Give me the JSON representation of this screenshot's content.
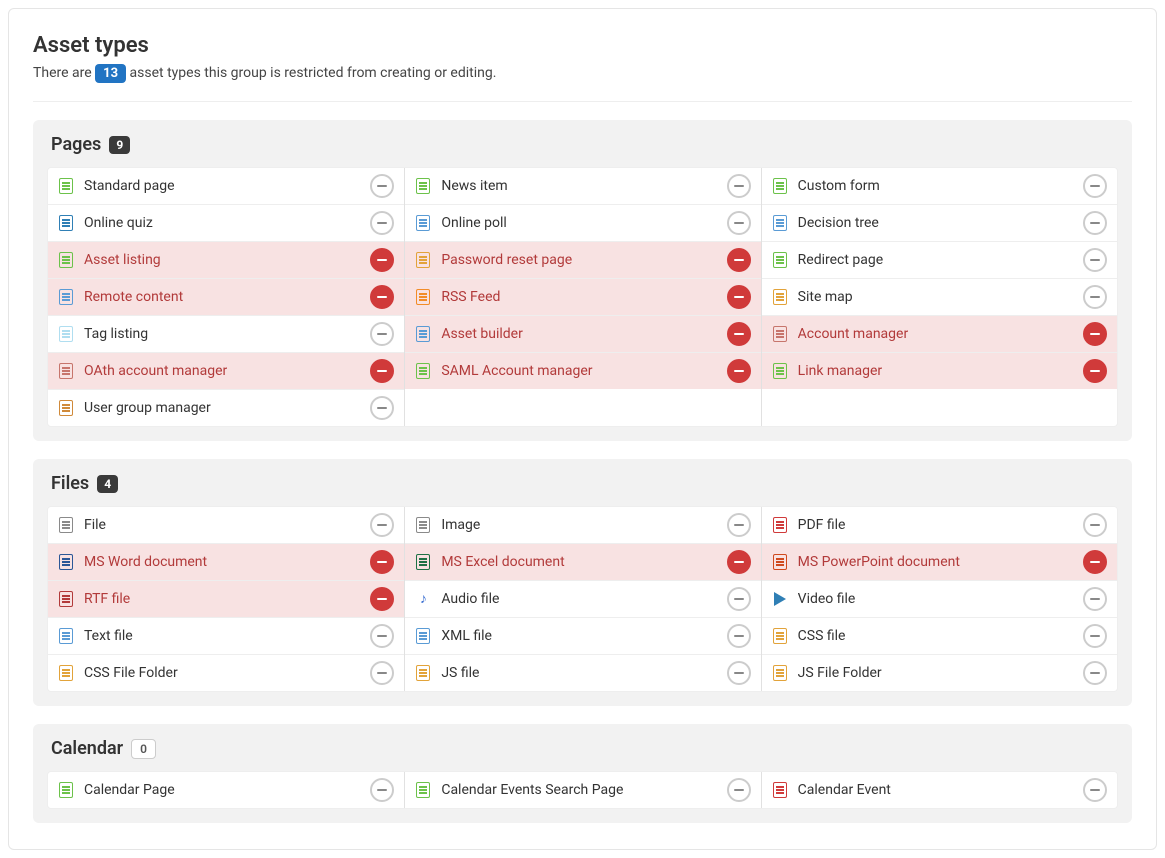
{
  "header": {
    "title": "Asset types",
    "subtitle_pre": "There are",
    "count": "13",
    "subtitle_post": "asset types this group is restricted from creating or editing."
  },
  "icons": {
    "page-green": {
      "kind": "doc",
      "color": "#6cc24a"
    },
    "quiz": {
      "kind": "doc",
      "color": "#2f7fb5"
    },
    "asset-listing": {
      "kind": "doc",
      "color": "#6cc24a"
    },
    "remote": {
      "kind": "doc",
      "color": "#5a9bd5"
    },
    "tag": {
      "kind": "doc",
      "color": "#b0def0"
    },
    "oauth": {
      "kind": "doc",
      "color": "#c7756c"
    },
    "user-group": {
      "kind": "doc",
      "color": "#d08a3a"
    },
    "news": {
      "kind": "doc",
      "color": "#6cc24a"
    },
    "poll": {
      "kind": "doc",
      "color": "#5a9bd5"
    },
    "password": {
      "kind": "doc",
      "color": "#e2a33a"
    },
    "rss": {
      "kind": "doc",
      "color": "#f28c28"
    },
    "builder": {
      "kind": "doc",
      "color": "#5a9bd5"
    },
    "saml": {
      "kind": "doc",
      "color": "#6cc24a"
    },
    "form": {
      "kind": "doc",
      "color": "#6cc24a"
    },
    "decision": {
      "kind": "doc",
      "color": "#5a9bd5"
    },
    "redirect": {
      "kind": "doc",
      "color": "#6cc24a"
    },
    "sitemap": {
      "kind": "doc",
      "color": "#e2a33a"
    },
    "account-mgr": {
      "kind": "doc",
      "color": "#c7756c"
    },
    "link-mgr": {
      "kind": "doc",
      "color": "#6cc24a"
    },
    "file": {
      "kind": "doc",
      "color": "#8a8a8a"
    },
    "word": {
      "kind": "doc",
      "color": "#2b5797"
    },
    "rtf": {
      "kind": "doc",
      "color": "#b23a3a"
    },
    "text": {
      "kind": "doc",
      "color": "#5a9bd5"
    },
    "css-folder": {
      "kind": "doc",
      "color": "#e2a33a"
    },
    "image": {
      "kind": "doc",
      "color": "#8a8a8a"
    },
    "excel": {
      "kind": "doc",
      "color": "#1e7145"
    },
    "audio": {
      "kind": "note",
      "color": "#3b6fd1",
      "glyph": "♪"
    },
    "xml": {
      "kind": "doc",
      "color": "#5a9bd5"
    },
    "js": {
      "kind": "doc",
      "color": "#e2a33a"
    },
    "pdf": {
      "kind": "doc",
      "color": "#d03a3a"
    },
    "ppt": {
      "kind": "doc",
      "color": "#d04a1e"
    },
    "video": {
      "kind": "play",
      "color": "#2f7fb5"
    },
    "css": {
      "kind": "doc",
      "color": "#e2a33a"
    },
    "js-folder": {
      "kind": "doc",
      "color": "#e2a33a"
    },
    "cal-green": {
      "kind": "doc",
      "color": "#6cc24a"
    },
    "cal-red": {
      "kind": "doc",
      "color": "#d03a3a"
    }
  },
  "sections": [
    {
      "title": "Pages",
      "count": "9",
      "count_style": "dark",
      "columns": [
        [
          {
            "label": "Standard page",
            "restricted": false,
            "icon": "page-green"
          },
          {
            "label": "Online quiz",
            "restricted": false,
            "icon": "quiz"
          },
          {
            "label": "Asset listing",
            "restricted": true,
            "icon": "asset-listing"
          },
          {
            "label": "Remote content",
            "restricted": true,
            "icon": "remote"
          },
          {
            "label": "Tag listing",
            "restricted": false,
            "icon": "tag"
          },
          {
            "label": "OAth account manager",
            "restricted": true,
            "icon": "oauth"
          },
          {
            "label": "User group manager",
            "restricted": false,
            "icon": "user-group"
          }
        ],
        [
          {
            "label": "News item",
            "restricted": false,
            "icon": "news"
          },
          {
            "label": "Online poll",
            "restricted": false,
            "icon": "poll"
          },
          {
            "label": "Password reset page",
            "restricted": true,
            "icon": "password"
          },
          {
            "label": "RSS Feed",
            "restricted": true,
            "icon": "rss"
          },
          {
            "label": "Asset builder",
            "restricted": true,
            "icon": "builder"
          },
          {
            "label": "SAML Account manager",
            "restricted": true,
            "icon": "saml"
          }
        ],
        [
          {
            "label": "Custom form",
            "restricted": false,
            "icon": "form"
          },
          {
            "label": "Decision tree",
            "restricted": false,
            "icon": "decision"
          },
          {
            "label": "Redirect page",
            "restricted": false,
            "icon": "redirect"
          },
          {
            "label": "Site map",
            "restricted": false,
            "icon": "sitemap"
          },
          {
            "label": "Account manager",
            "restricted": true,
            "icon": "account-mgr"
          },
          {
            "label": "Link manager",
            "restricted": true,
            "icon": "link-mgr"
          }
        ]
      ]
    },
    {
      "title": "Files",
      "count": "4",
      "count_style": "dark",
      "columns": [
        [
          {
            "label": "File",
            "restricted": false,
            "icon": "file"
          },
          {
            "label": "MS Word document",
            "restricted": true,
            "icon": "word"
          },
          {
            "label": "RTF file",
            "restricted": true,
            "icon": "rtf"
          },
          {
            "label": "Text file",
            "restricted": false,
            "icon": "text"
          },
          {
            "label": "CSS File Folder",
            "restricted": false,
            "icon": "css-folder"
          }
        ],
        [
          {
            "label": "Image",
            "restricted": false,
            "icon": "image"
          },
          {
            "label": "MS Excel document",
            "restricted": true,
            "icon": "excel"
          },
          {
            "label": "Audio file",
            "restricted": false,
            "icon": "audio"
          },
          {
            "label": "XML file",
            "restricted": false,
            "icon": "xml"
          },
          {
            "label": "JS file",
            "restricted": false,
            "icon": "js"
          }
        ],
        [
          {
            "label": "PDF file",
            "restricted": false,
            "icon": "pdf"
          },
          {
            "label": "MS PowerPoint document",
            "restricted": true,
            "icon": "ppt"
          },
          {
            "label": "Video file",
            "restricted": false,
            "icon": "video"
          },
          {
            "label": "CSS file",
            "restricted": false,
            "icon": "css"
          },
          {
            "label": "JS File Folder",
            "restricted": false,
            "icon": "js-folder"
          }
        ]
      ]
    },
    {
      "title": "Calendar",
      "count": "0",
      "count_style": "light",
      "columns": [
        [
          {
            "label": "Calendar Page",
            "restricted": false,
            "icon": "cal-green"
          }
        ],
        [
          {
            "label": "Calendar Events Search Page",
            "restricted": false,
            "icon": "cal-green"
          }
        ],
        [
          {
            "label": "Calendar Event",
            "restricted": false,
            "icon": "cal-red"
          }
        ]
      ]
    }
  ]
}
